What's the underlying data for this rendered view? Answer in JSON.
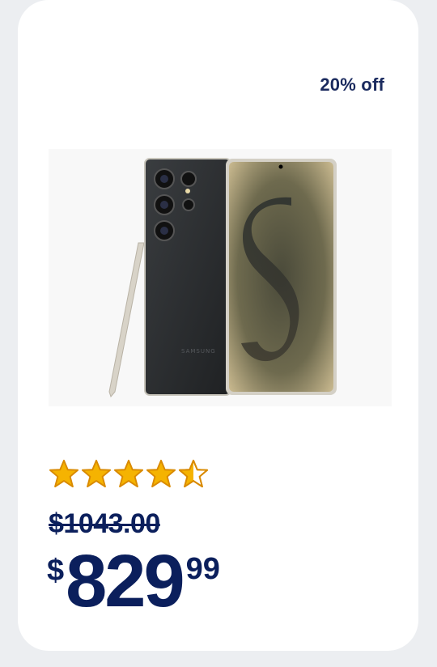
{
  "product": {
    "discount_badge": "20% off",
    "image": {
      "alt": "Samsung Galaxy smartphone with stylus",
      "brand_mark": "SAMSUNG"
    },
    "rating": {
      "value": 4.5,
      "max": 5
    },
    "old_price": "$1043.00",
    "price": {
      "currency": "$",
      "dollars": "829",
      "cents": "99"
    }
  },
  "colors": {
    "accent_navy": "#0b1f5c",
    "star_fill": "#f5b301",
    "star_outline": "#d98a00",
    "card_bg": "#ffffff",
    "page_bg": "#eceef1"
  }
}
